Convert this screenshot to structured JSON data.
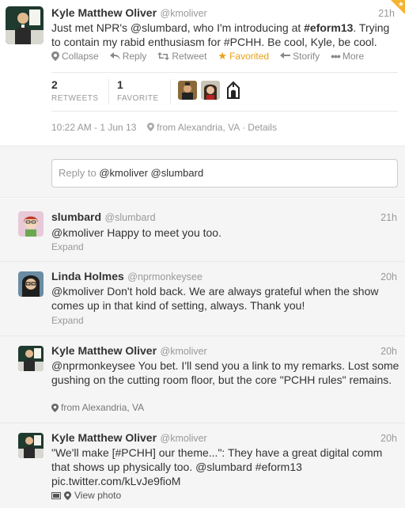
{
  "main_tweet": {
    "name": "Kyle Matthew Oliver",
    "handle": "@kmoliver",
    "time": "21h",
    "text_parts": {
      "p1": "Just met NPR's ",
      "mention": "@slumbard",
      "p2": ", who I'm introducing at ",
      "hashtag": "#eform13",
      "p3": ". Trying to contain my rabid enthusiasm for ",
      "hashtag2": "#PCHH",
      "p4": ". Be cool, Kyle, be cool."
    },
    "actions": {
      "collapse": "Collapse",
      "reply": "Reply",
      "retweet": "Retweet",
      "favorited": "Favorited",
      "storify": "Storify",
      "more": "More"
    },
    "stats": {
      "retweets_count": "2",
      "retweets_label": "RETWEETS",
      "favorites_count": "1",
      "favorites_label": "FAVORITE"
    },
    "meta": {
      "datetime": "10:22 AM - 1 Jun 13",
      "location": "from Alexandria, VA",
      "separator": "·",
      "details": "Details"
    }
  },
  "reply_box": {
    "prefix": "Reply to ",
    "value": "@kmoliver @slumbard"
  },
  "replies": [
    {
      "name": "slumbard",
      "handle": "@slumbard",
      "time": "21h",
      "text": "@kmoliver  Happy to meet you too.",
      "footer": "Expand"
    },
    {
      "name": "Linda Holmes",
      "handle": "@nprmonkeysee",
      "time": "20h",
      "text": "@kmoliver Don't hold back. We are always grateful when the show comes up in that kind of setting, always. Thank you!",
      "footer": "Expand"
    },
    {
      "name": "Kyle Matthew Oliver",
      "handle": "@kmoliver",
      "time": "20h",
      "text": "@nprmonkeysee You bet. I'll send you a link to my remarks. Lost some gushing on the cutting room floor, but the core \"PCHH rules\" remains.",
      "footer": "from Alexandria, VA"
    },
    {
      "name": "Kyle Matthew Oliver",
      "handle": "@kmoliver",
      "time": "20h",
      "text": "\"We'll make [#PCHH] our theme...\": They have a great digital comm that shows up physically too. @slumbard #eform13 pic.twitter.com/kLvJe9fioM",
      "footer": "View photo"
    }
  ],
  "colors": {
    "favorite": "#e8a118",
    "muted": "#999999",
    "text": "#333333",
    "conversation_bg": "#f5f5f5"
  }
}
